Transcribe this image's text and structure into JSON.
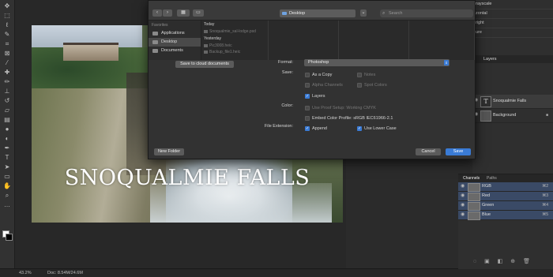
{
  "toolbar": {
    "tools": [
      "move",
      "marquee",
      "lasso",
      "quick-select",
      "crop",
      "frame",
      "eyedropper",
      "healing",
      "brush",
      "clone-stamp",
      "history-brush",
      "eraser",
      "gradient",
      "blur",
      "dodge",
      "pen",
      "type",
      "path-select",
      "rectangle",
      "hand",
      "zoom",
      "more"
    ]
  },
  "canvas": {
    "title_text": "SNOQUALMIE FALLS"
  },
  "statusbar": {
    "zoom": "43.2%",
    "doc_size": "Doc: 8.54M/24.6M"
  },
  "adjustments_list": [
    "rayscale",
    "zontal",
    "right",
    "ure"
  ],
  "layers_panel": {
    "header": "Layers",
    "layers": [
      {
        "name": "Snoqualmie Falls",
        "type": "text"
      },
      {
        "name": "Background",
        "type": "image",
        "locked": true
      }
    ]
  },
  "channels_panel": {
    "tabs": [
      "Channels",
      "Paths"
    ],
    "channels": [
      {
        "name": "RGB",
        "shortcut": "⌘2"
      },
      {
        "name": "Red",
        "shortcut": "⌘3"
      },
      {
        "name": "Green",
        "shortcut": "⌘4"
      },
      {
        "name": "Blue",
        "shortcut": "⌘5"
      }
    ]
  },
  "dialog": {
    "location": "Desktop",
    "search_placeholder": "Search",
    "favorites_header": "Favorites",
    "sidebar_items": [
      "Applications",
      "Desktop",
      "Documents"
    ],
    "browser_groups": [
      {
        "label": "Today",
        "files": [
          "Snoqualmie_sal-lodge.psd"
        ]
      },
      {
        "label": "Yesterday",
        "files": [
          "Pic3008.heic",
          "Backup_file1.heic"
        ]
      }
    ],
    "cloud_button": "Save to cloud documents",
    "format_label": "Format:",
    "format_value": "Photoshop",
    "save_label": "Save:",
    "save_options": [
      {
        "label": "As a Copy",
        "checked": false,
        "disabled": false
      },
      {
        "label": "Notes",
        "checked": false,
        "disabled": true
      },
      {
        "label": "Alpha Channels",
        "checked": false,
        "disabled": true
      },
      {
        "label": "Spot Colors",
        "checked": false,
        "disabled": true
      },
      {
        "label": "Layers",
        "checked": true,
        "disabled": false
      }
    ],
    "color_label": "Color:",
    "color_options": [
      {
        "label": "Use Proof Setup:  Working CMYK",
        "checked": false,
        "disabled": true
      },
      {
        "label": "Embed Color Profile:  sRGB IEC61966-2.1",
        "checked": false,
        "disabled": false
      }
    ],
    "ext_label": "File Extension:",
    "ext_options": [
      {
        "label": "Append",
        "checked": true
      },
      {
        "label": "Use Lower Case",
        "checked": true
      }
    ],
    "new_folder": "New Folder",
    "cancel": "Cancel",
    "save": "Save"
  },
  "colors": {
    "accent": "#3a7bd5",
    "panel": "#2f2f2f",
    "dialog": "#323232"
  }
}
